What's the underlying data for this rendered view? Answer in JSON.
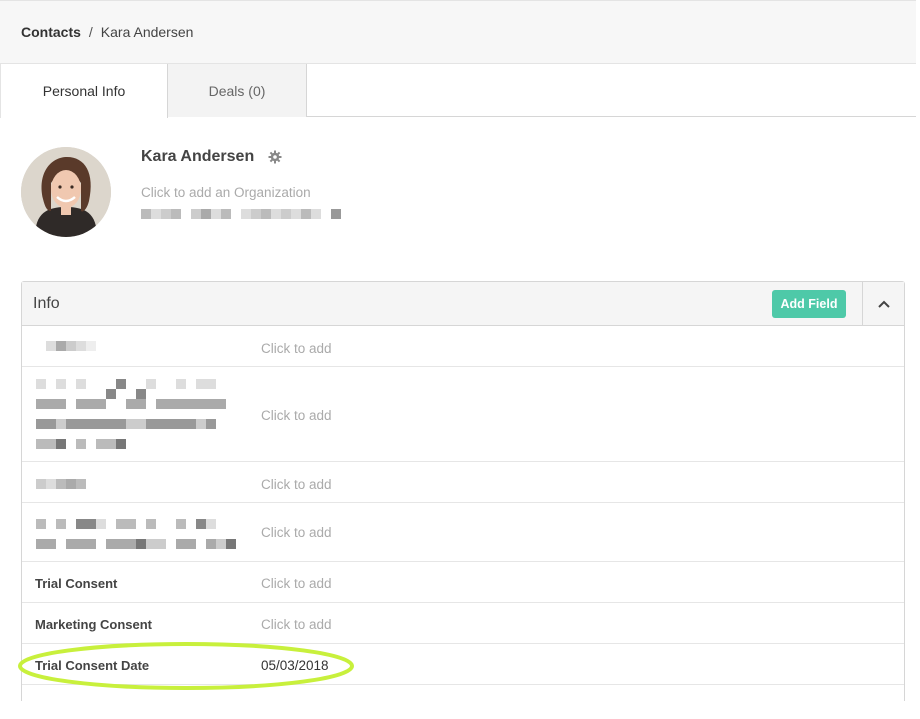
{
  "breadcrumb": {
    "root": "Contacts",
    "separator": "/",
    "current": "Kara Andersen"
  },
  "tabs": [
    {
      "label": "Personal Info",
      "active": true
    },
    {
      "label": "Deals (0)",
      "active": false
    }
  ],
  "contact": {
    "name": "Kara Andersen",
    "organization_placeholder": "Click to add an Organization"
  },
  "info": {
    "title": "Info",
    "add_field_label": "Add Field",
    "collapse_icon": "chevron-up-icon",
    "rows": [
      {
        "label": "",
        "value": "Click to add"
      },
      {
        "label": "",
        "value": "Click to add"
      },
      {
        "label": "",
        "value": "Click to add"
      },
      {
        "label": "",
        "value": "Click to add"
      },
      {
        "label": "Trial Consent",
        "value": "Click to add"
      },
      {
        "label": "Marketing Consent",
        "value": "Click to add"
      },
      {
        "label": "Trial Consent Date",
        "value": "05/03/2018"
      }
    ]
  },
  "colors": {
    "accent": "#4ec9a8",
    "highlight": "#c8f03c",
    "placeholder": "#aaaaaa"
  }
}
